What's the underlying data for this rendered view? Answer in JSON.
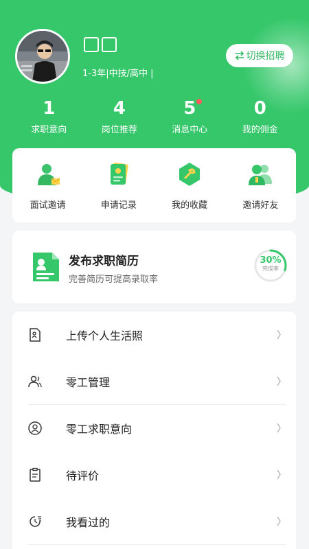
{
  "profile": {
    "name_glyphs": [
      "⃞",
      "⃞"
    ],
    "meta": "1-3年|中技/高中 |",
    "switch_label": "切换招聘"
  },
  "stats": [
    {
      "value": "1",
      "label": "求职意向"
    },
    {
      "value": "4",
      "label": "岗位推荐"
    },
    {
      "value": "5",
      "label": "消息中心"
    },
    {
      "value": "0",
      "label": "我的佣金"
    }
  ],
  "quick": [
    {
      "label": "面试邀请",
      "icon": "interview-icon"
    },
    {
      "label": "申请记录",
      "icon": "application-record-icon"
    },
    {
      "label": "我的收藏",
      "icon": "favorites-icon"
    },
    {
      "label": "邀请好友",
      "icon": "invite-friends-icon"
    }
  ],
  "resume": {
    "title": "发布求职简历",
    "subtitle": "完善简历可提高录取率",
    "percent_text": "30%",
    "percent_value": 30,
    "percent_caption": "完成率"
  },
  "menu": [
    {
      "label": "上传个人生活照",
      "icon": "photo-document-icon"
    },
    {
      "label": "零工管理",
      "icon": "users-icon"
    },
    {
      "label": "零工求职意向",
      "icon": "user-circle-icon"
    },
    {
      "label": "待评价",
      "icon": "clipboard-icon"
    },
    {
      "label": "我看过的",
      "icon": "history-icon"
    }
  ],
  "colors": {
    "brand": "#35c76a",
    "badge": "#ff5a5a"
  }
}
